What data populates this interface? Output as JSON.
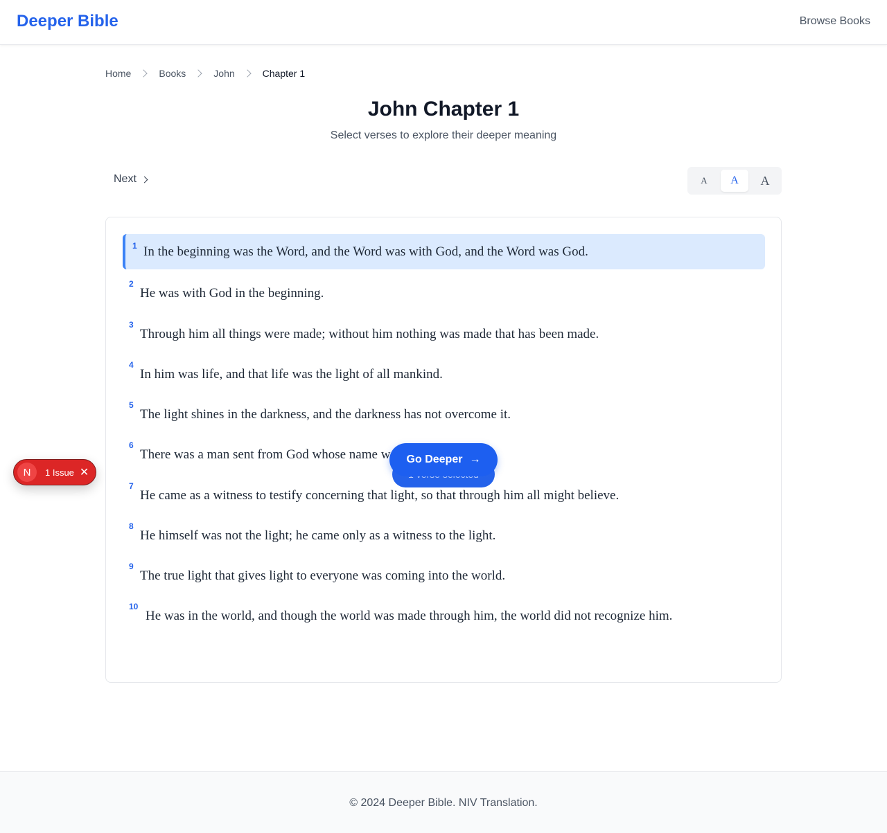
{
  "header": {
    "logo": "Deeper Bible",
    "browse_label": "Browse Books"
  },
  "breadcrumb": {
    "home": "Home",
    "books": "Books",
    "book": "John",
    "current": "Chapter 1"
  },
  "page": {
    "title": "John Chapter 1",
    "subtitle": "Select verses to explore their deeper meaning"
  },
  "nav": {
    "next_label": "Next"
  },
  "font_size": {
    "small": "A",
    "medium": "A",
    "large": "A",
    "selected": "medium"
  },
  "verses": [
    {
      "num": "1",
      "text": "In the beginning was the Word, and the Word was with God, and the Word was God.",
      "selected": true
    },
    {
      "num": "2",
      "text": "He was with God in the beginning.",
      "selected": false
    },
    {
      "num": "3",
      "text": "Through him all things were made; without him nothing was made that has been made.",
      "selected": false
    },
    {
      "num": "4",
      "text": "In him was life, and that life was the light of all mankind.",
      "selected": false
    },
    {
      "num": "5",
      "text": "The light shines in the darkness, and the darkness has not overcome it.",
      "selected": false
    },
    {
      "num": "6",
      "text": "There was a man sent from God whose name w",
      "selected": false
    },
    {
      "num": "7",
      "text": "He came as a witness to testify concerning that light, so that through him all might believe.",
      "selected": false
    },
    {
      "num": "8",
      "text": "He himself was not the light; he came only as a witness to the light.",
      "selected": false
    },
    {
      "num": "9",
      "text": "The true light that gives light to everyone was coming into the world.",
      "selected": false
    },
    {
      "num": "10",
      "text": "He was in the world, and though the world was made through him, the world did not recognize him.",
      "selected": false
    }
  ],
  "action": {
    "go_deeper_label": "Go Deeper",
    "arrow": "→",
    "count_label": "1 verse selected"
  },
  "dev_overlay": {
    "badge": "N",
    "label": "1 Issue",
    "close": "✕"
  },
  "footer": {
    "copyright": "© 2024 Deeper Bible. NIV Translation."
  },
  "colors": {
    "accent": "#2563eb",
    "selected_bg": "#dbeafe",
    "issue_red": "#dc2626"
  }
}
